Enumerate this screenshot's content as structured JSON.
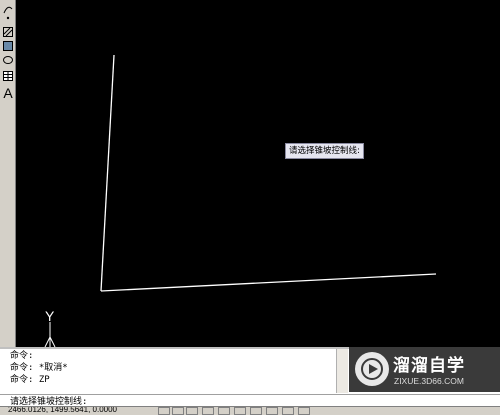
{
  "toolbar": {
    "buttons": [
      {
        "name": "point-icon"
      },
      {
        "name": "hatch-icon"
      },
      {
        "name": "gradient-icon"
      },
      {
        "name": "region-icon"
      },
      {
        "name": "table-icon"
      },
      {
        "name": "multiline-text-icon",
        "glyph": "A"
      }
    ]
  },
  "canvas": {
    "tooltip_text": "请选择锥坡控制线:",
    "ucs_y_label": "Y",
    "line_color": "#ffffff"
  },
  "command": {
    "history": [
      "命令:",
      "命令: *取消*",
      "命令: ZP"
    ],
    "prompt": "请选择锥坡控制线:"
  },
  "watermark": {
    "brand": "溜溜自学",
    "url": "ZIXUE.3D66.COM"
  },
  "status": {
    "coordinates": "2466.0126,  1499.5641,  0.0000"
  }
}
